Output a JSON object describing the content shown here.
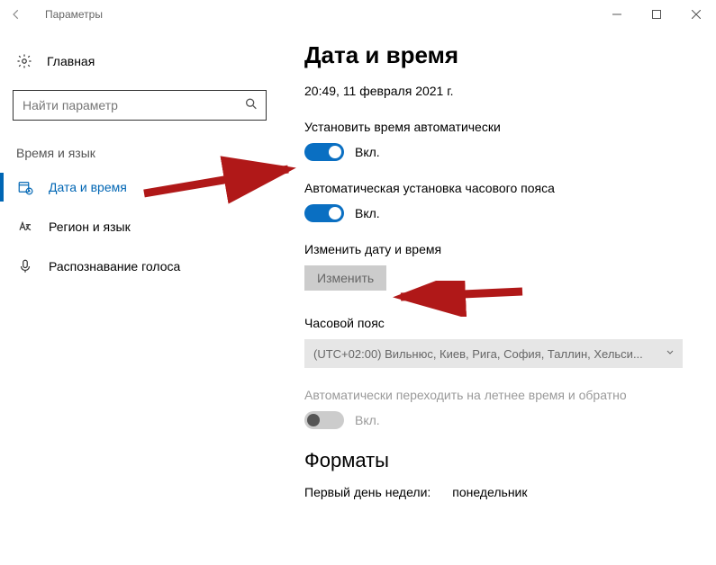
{
  "window": {
    "title": "Параметры",
    "buttons": {
      "min": "—",
      "max": "☐",
      "close": "✕"
    }
  },
  "sidebar": {
    "home": "Главная",
    "search_placeholder": "Найти параметр",
    "group": "Время и язык",
    "items": [
      {
        "label": "Дата и время"
      },
      {
        "label": "Регион и язык"
      },
      {
        "label": "Распознавание голоса"
      }
    ]
  },
  "main": {
    "heading": "Дата и время",
    "datetime_display": "20:49, 11 февраля 2021 г.",
    "auto_time": {
      "label": "Установить время автоматически",
      "state": "Вкл."
    },
    "auto_tz": {
      "label": "Автоматическая установка часового пояса",
      "state": "Вкл."
    },
    "change_dt": {
      "label": "Изменить дату и время",
      "button": "Изменить"
    },
    "timezone": {
      "label": "Часовой пояс",
      "value": "(UTC+02:00) Вильнюс, Киев, Рига, София, Таллин, Хельси..."
    },
    "dst": {
      "label": "Автоматически переходить на летнее время и обратно",
      "state": "Вкл."
    },
    "formats_heading": "Форматы",
    "first_day": {
      "label": "Первый день недели:",
      "value": "понедельник"
    }
  }
}
